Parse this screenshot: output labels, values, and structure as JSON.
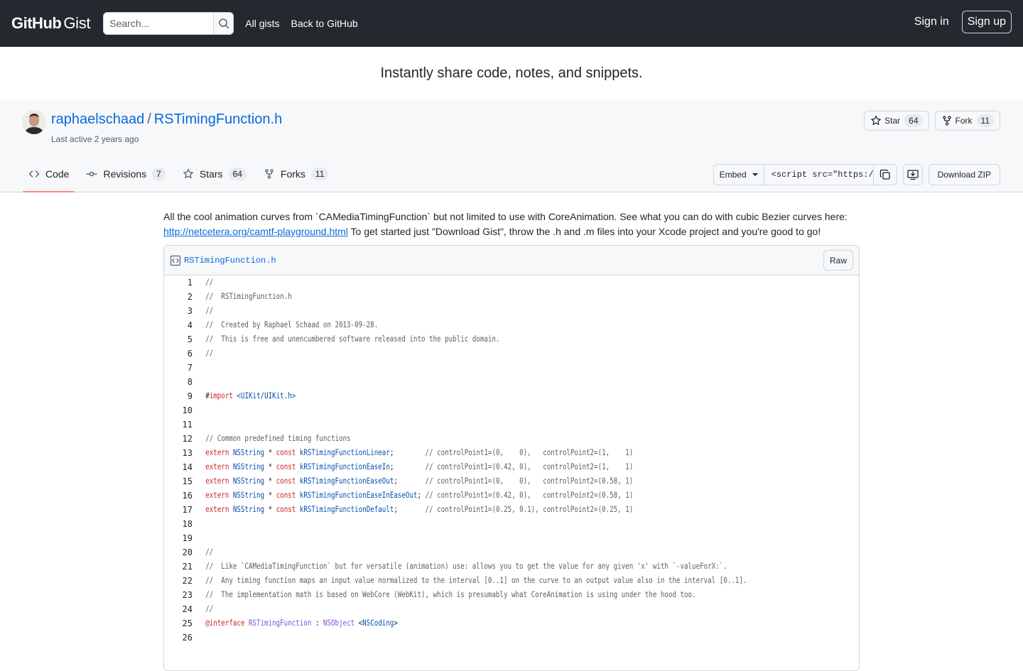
{
  "header": {
    "logo_github": "GitHub",
    "logo_gist": "Gist",
    "search_placeholder": "Search...",
    "nav": [
      "All gists",
      "Back to GitHub"
    ],
    "sign_in": "Sign in",
    "sign_up": "Sign up"
  },
  "tagline": "Instantly share code, notes, and snippets.",
  "gist": {
    "owner": "raphaelschaad",
    "filename_title": "RSTimingFunction.h",
    "last_active": "Last active 2 years ago",
    "star_label": "Star",
    "star_count": "64",
    "fork_label": "Fork",
    "fork_count": "11",
    "tabs": [
      {
        "label": "Code",
        "count": ""
      },
      {
        "label": "Revisions",
        "count": "7"
      },
      {
        "label": "Stars",
        "count": "64"
      },
      {
        "label": "Forks",
        "count": "11"
      }
    ],
    "embed_label": "Embed",
    "embed_value": "<script src=\"https://gist.github.com/",
    "download_zip": "Download ZIP"
  },
  "description": {
    "text_before": "All the cool animation curves from `CAMediaTimingFunction` but not limited to use with CoreAnimation. See what you can do with cubic Bezier curves here:",
    "link": "http://netcetera.org/camtf-playground.html",
    "text_after": " To get started just \"Download Gist\", throw the .h and .m files into your Xcode project and you're good to go!"
  },
  "file": {
    "name": "RSTimingFunction.h",
    "raw_label": "Raw",
    "lines": [
      {
        "n": "1",
        "t": "//"
      },
      {
        "n": "2",
        "t": "//  RSTimingFunction.h"
      },
      {
        "n": "3",
        "t": "//"
      },
      {
        "n": "4",
        "t": "//  Created by Raphael Schaad on 2013-09-28."
      },
      {
        "n": "5",
        "t": "//  This is free and unencumbered software released into the public domain."
      },
      {
        "n": "6",
        "t": "//"
      },
      {
        "n": "7",
        "t": ""
      },
      {
        "n": "8",
        "t": ""
      },
      {
        "n": "9",
        "t": "#import <UIKit/UIKit.h>"
      },
      {
        "n": "10",
        "t": ""
      },
      {
        "n": "11",
        "t": ""
      },
      {
        "n": "12",
        "t": "// Common predefined timing functions"
      },
      {
        "n": "13",
        "t": "extern NSString * const kRSTimingFunctionLinear;        // controlPoint1=(0,    0),   controlPoint2=(1,    1)"
      },
      {
        "n": "14",
        "t": "extern NSString * const kRSTimingFunctionEaseIn;        // controlPoint1=(0.42, 0),   controlPoint2=(1,    1)"
      },
      {
        "n": "15",
        "t": "extern NSString * const kRSTimingFunctionEaseOut;       // controlPoint1=(0,    0),   controlPoint2=(0.58, 1)"
      },
      {
        "n": "16",
        "t": "extern NSString * const kRSTimingFunctionEaseInEaseOut; // controlPoint1=(0.42, 0),   controlPoint2=(0.58, 1)"
      },
      {
        "n": "17",
        "t": "extern NSString * const kRSTimingFunctionDefault;       // controlPoint1=(0.25, 0.1), controlPoint2=(0.25, 1)"
      },
      {
        "n": "18",
        "t": ""
      },
      {
        "n": "19",
        "t": ""
      },
      {
        "n": "20",
        "t": "//"
      },
      {
        "n": "21",
        "t": "//  Like `CAMediaTimingFunction` but for versatile (animation) use: allows you to get the value for any given 'x' with `-valueForX:`."
      },
      {
        "n": "22",
        "t": "//  Any timing function maps an input value normalized to the interval [0..1] on the curve to an output value also in the interval [0..1]."
      },
      {
        "n": "23",
        "t": "//  The implementation math is based on WebCore (WebKit), which is presumably what CoreAnimation is using under the hood too."
      },
      {
        "n": "24",
        "t": "//"
      },
      {
        "n": "25",
        "t": "@interface RSTimingFunction : NSObject <NSCoding>"
      },
      {
        "n": "26",
        "t": ""
      }
    ]
  }
}
